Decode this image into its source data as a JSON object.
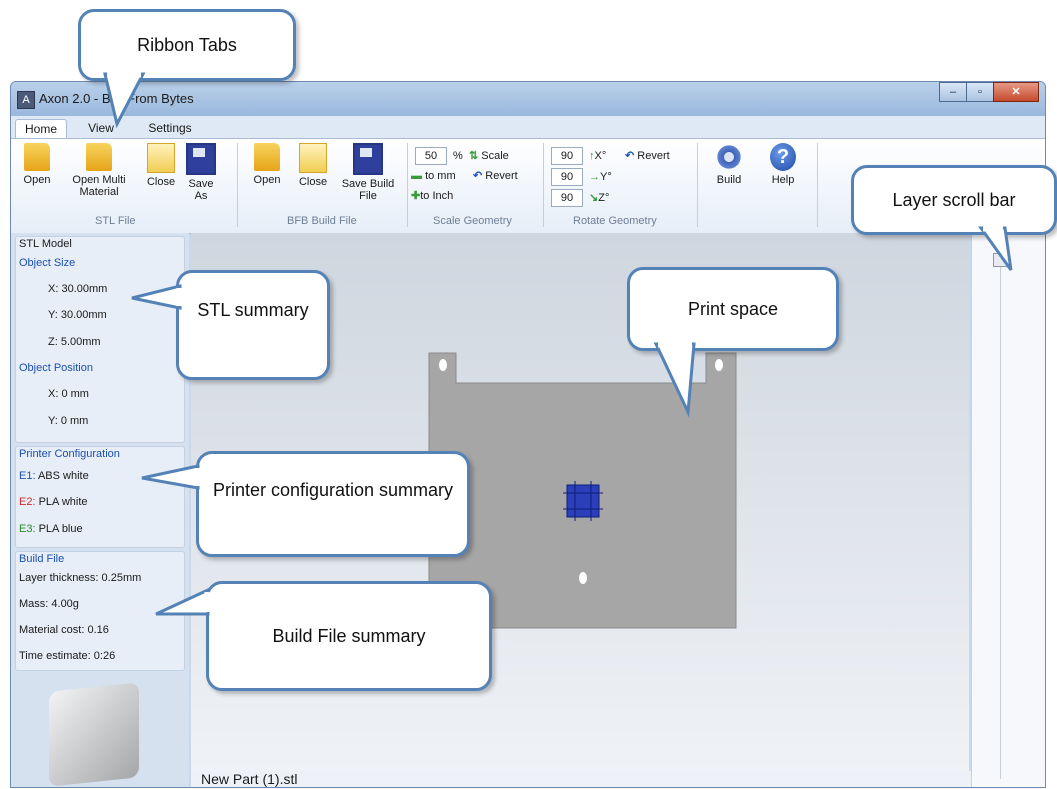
{
  "window": {
    "title": "Axon 2.0 - Bits From Bytes",
    "controls": {
      "minimize_icon": "minimize-icon",
      "maximize_icon": "maximize-icon",
      "close_icon": "close-icon"
    }
  },
  "tabs": [
    {
      "label": "Home",
      "active": true
    },
    {
      "label": "View",
      "active": false
    },
    {
      "label": "Settings",
      "active": false
    }
  ],
  "ribbon": {
    "stl_file": {
      "group_label": "STL File",
      "buttons": [
        {
          "label": "Open",
          "icon": "folder-icon"
        },
        {
          "label": "Open Multi Material",
          "icon": "folder-icon"
        },
        {
          "label": "Close",
          "icon": "page-icon"
        },
        {
          "label": "Save As",
          "icon": "save-icon"
        }
      ]
    },
    "bfb_build_file": {
      "group_label": "BFB Build File",
      "buttons": [
        {
          "label": "Open",
          "icon": "folder-icon"
        },
        {
          "label": "Close",
          "icon": "page-icon"
        },
        {
          "label": "Save Build File",
          "icon": "save-icon"
        }
      ]
    },
    "scale_geometry": {
      "group_label": "Scale Geometry",
      "value": "50",
      "unit": "%",
      "scale_label": "Scale",
      "to_mm_label": "to mm",
      "revert_label": "Revert",
      "to_inch_label": "to Inch"
    },
    "rotate_geometry": {
      "group_label": "Rotate Geometry",
      "x_value": "90",
      "y_value": "90",
      "z_value": "90",
      "x_label": "X°",
      "y_label": "Y°",
      "z_label": "Z°",
      "revert_label": "Revert"
    },
    "build": {
      "label": "Build",
      "icon": "gear-icon"
    },
    "help": {
      "label": "Help",
      "icon": "help-icon"
    }
  },
  "left_panel": {
    "stl_model": {
      "title": "STL Model",
      "object_size_title": "Object Size",
      "x": "X:  30.00mm",
      "y": "Y:  30.00mm",
      "z": "Z:  5.00mm",
      "object_position_title": "Object Position",
      "pos_x": "X:  0 mm",
      "pos_y": "Y:  0 mm"
    },
    "printer_configuration": {
      "title": "Printer Configuration",
      "entries": [
        {
          "id": "E1:",
          "text": "ABS white",
          "color": "#1c4fb0"
        },
        {
          "id": "E2:",
          "text": "PLA white",
          "color": "#d42a2a"
        },
        {
          "id": "E3:",
          "text": "PLA blue",
          "color": "#2a8a2a"
        }
      ]
    },
    "build_file": {
      "title": "Build File",
      "layer_thickness": "Layer thickness:  0.25mm",
      "mass": "Mass:  4.00g",
      "material_cost": "Material cost:  0.16",
      "time_estimate": "Time estimate:  0:26"
    }
  },
  "viewport": {
    "file_name": "New Part (1).stl"
  },
  "callouts": {
    "ribbon_tabs": "Ribbon Tabs",
    "layer_scroll_bar": "Layer scroll bar",
    "stl_summary": "STL summary",
    "print_space": "Print space",
    "printer_config_summary": "Printer configuration summary",
    "build_file_summary": "Build File summary"
  },
  "colors": {
    "accent": "#5482b6",
    "ribbon_bg": "#e6eef8",
    "panel_bg": "#d5e1ef"
  }
}
